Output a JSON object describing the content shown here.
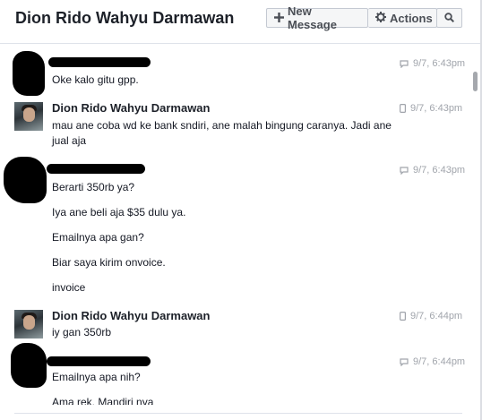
{
  "header": {
    "title": "Dion Rido Wahyu Darmawan",
    "new_message": "New Message",
    "actions": "Actions"
  },
  "messages": [
    {
      "sender": "",
      "time": "9/7, 6:43pm",
      "lines": [
        "Oke kalo gitu gpp."
      ]
    },
    {
      "sender": "Dion Rido Wahyu Darmawan",
      "time": "9/7, 6:43pm",
      "lines": [
        "mau ane coba wd ke bank sndiri, ane malah bingung caranya. Jadi ane",
        "jual aja"
      ]
    },
    {
      "sender": "",
      "time": "9/7, 6:43pm",
      "lines": [
        "Berarti 350rb ya?",
        "Iya ane beli aja $35 dulu ya.",
        "Emailnya apa gan?",
        "Biar saya kirim onvoice.",
        "invoice"
      ]
    },
    {
      "sender": "Dion Rido Wahyu Darmawan",
      "time": "9/7, 6:44pm",
      "lines": [
        "iy gan 350rb"
      ]
    },
    {
      "sender": "",
      "time": "9/7, 6:44pm",
      "lines": [
        "Emailnya apa nih?",
        "Ama rek. Mandiri nya"
      ]
    }
  ]
}
